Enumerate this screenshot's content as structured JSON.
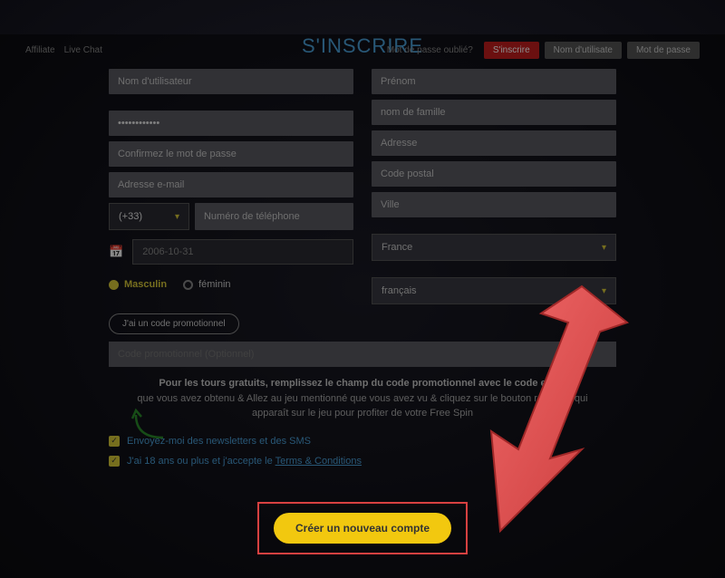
{
  "topbar": {
    "affiliate": "Affiliate",
    "livechat": "Live Chat",
    "forgot": "Mot de passe oublié?",
    "signup": "S'inscrire",
    "username": "Nom d'utilisate",
    "password": "Mot de passe"
  },
  "title": "S'INSCRIRE",
  "left": {
    "username_ph": "Nom d'utilisateur",
    "password_value": "************",
    "confirm_ph": "Confirmez le mot de passe",
    "email_ph": "Adresse e-mail",
    "dial_code": "(+33)",
    "phone_ph": "Numéro de téléphone",
    "date_value": "2006-10-31",
    "gender_m": "Masculin",
    "gender_f": "féminin"
  },
  "right": {
    "firstname_ph": "Prénom",
    "lastname_ph": "nom de famille",
    "address_ph": "Adresse",
    "postal_ph": "Code postal",
    "city_ph": "Ville",
    "country": "France",
    "language": "français"
  },
  "promo": {
    "button": "J'ai un code promotionnel",
    "input_ph": "Code promotionnel (Optionnel)",
    "tours_bold": "Pour les tours gratuits, remplissez le champ du code promotionnel avec le code exact",
    "tours_rest": "que vous avez obtenu & Allez au jeu mentionné que vous avez vu & cliquez sur le bouton real play qui apparaît sur le jeu pour profiter de votre Free Spin"
  },
  "checks": {
    "newsletter": "Envoyez-moi des newsletters et des SMS",
    "age_prefix": "J'ai 18 ans ou plus et j'accepte le ",
    "terms": "Terms & Conditions"
  },
  "submit": "Créer un nouveau compte"
}
